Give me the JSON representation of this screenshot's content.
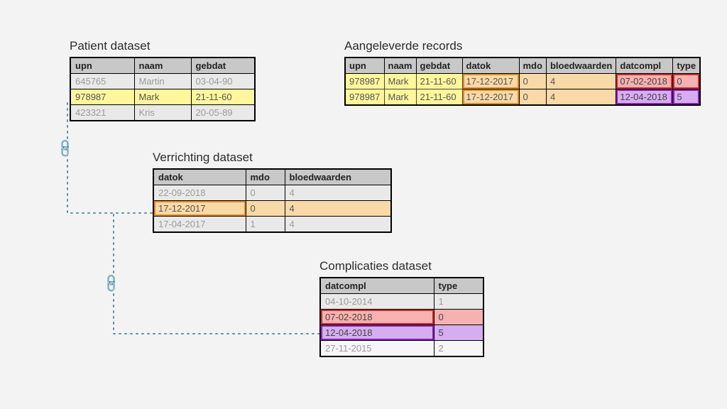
{
  "patient": {
    "title": "Patient dataset",
    "headers": [
      "upn",
      "naam",
      "gebdat"
    ],
    "rows": [
      {
        "upn": "645765",
        "naam": "Martin",
        "gebdat": "03-04-90",
        "hl": ""
      },
      {
        "upn": "978987",
        "naam": "Mark",
        "gebdat": "21-11-60",
        "hl": "yellow"
      },
      {
        "upn": "423321",
        "naam": "Kris",
        "gebdat": "20-05-89",
        "hl": ""
      }
    ]
  },
  "verrichting": {
    "title": "Verrichting dataset",
    "headers": [
      "datok",
      "mdo",
      "bloedwaarden"
    ],
    "rows": [
      {
        "datok": "22-09-2018",
        "mdo": "0",
        "bloedwaarden": "4",
        "hl": ""
      },
      {
        "datok": "17-12-2017",
        "mdo": "0",
        "bloedwaarden": "4",
        "hl": "orange"
      },
      {
        "datok": "17-04-2017",
        "mdo": "1",
        "bloedwaarden": "4",
        "hl": ""
      }
    ]
  },
  "complicaties": {
    "title": "Complicaties dataset",
    "headers": [
      "datcompl",
      "type"
    ],
    "rows": [
      {
        "datcompl": "04-10-2014",
        "type": "1",
        "hl": ""
      },
      {
        "datcompl": "07-02-2018",
        "type": "0",
        "hl": "red"
      },
      {
        "datcompl": "12-04-2018",
        "type": "5",
        "hl": "purple"
      },
      {
        "datcompl": "27-11-2015",
        "type": "2",
        "hl": ""
      }
    ]
  },
  "aangeleverde": {
    "title": "Aangeleverde records",
    "headers": [
      "upn",
      "naam",
      "gebdat",
      "datok",
      "mdo",
      "bloedwaarden",
      "datcompl",
      "type"
    ],
    "rows": [
      {
        "upn": "978987",
        "naam": "Mark",
        "gebdat": "21-11-60",
        "datok": "17-12-2017",
        "mdo": "0",
        "bloedwaarden": "4",
        "datcompl": "07-02-2018",
        "type": "0",
        "comp": "red"
      },
      {
        "upn": "978987",
        "naam": "Mark",
        "gebdat": "21-11-60",
        "datok": "17-12-2017",
        "mdo": "0",
        "bloedwaarden": "4",
        "datcompl": "12-04-2018",
        "type": "5",
        "comp": "purple"
      }
    ]
  }
}
